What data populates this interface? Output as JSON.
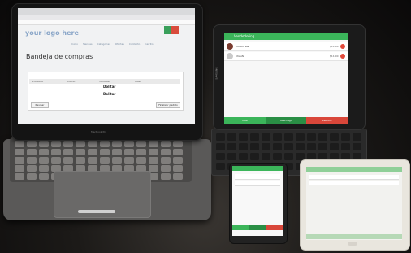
{
  "laptop": {
    "site_logo": "your logo here",
    "nav_items": [
      "Inicio",
      "Tiendas",
      "Categorias",
      "Ofertas",
      "Contacto",
      "Carrito"
    ],
    "page_heading": "Bandeja de compras",
    "cart_table": {
      "headers": [
        "Producto",
        "Precio",
        "Cantidad",
        "Total"
      ],
      "prices": [
        "Dolitar",
        "Dolitar"
      ],
      "left_button": "Revisar",
      "right_button": "Finalizar pedido"
    },
    "brand": "MacBook Pro"
  },
  "tablet": {
    "app_title": "Vendedoring",
    "orders": [
      {
        "name": "Cordon Ble",
        "price": "$11.00"
      },
      {
        "name": "Chaufa",
        "price": "$11.00"
      }
    ],
    "footer": [
      "Total",
      "Total Pago",
      "Pedidos"
    ],
    "footer_colors": [
      "#3bb55a",
      "#2a8f45",
      "#d9473a"
    ],
    "brand": "SAMSUNG"
  },
  "phone": {
    "footer_colors": [
      "#3bb55a",
      "#2a8f45",
      "#d9473a"
    ]
  },
  "dock_colors": [
    "#3b82f6",
    "#f59e0b",
    "#22c55e",
    "#ef4444",
    "#a855f7",
    "#06b6d4",
    "#f97316",
    "#84cc16",
    "#e11d48",
    "#0ea5e9",
    "#facc15",
    "#10b981"
  ]
}
